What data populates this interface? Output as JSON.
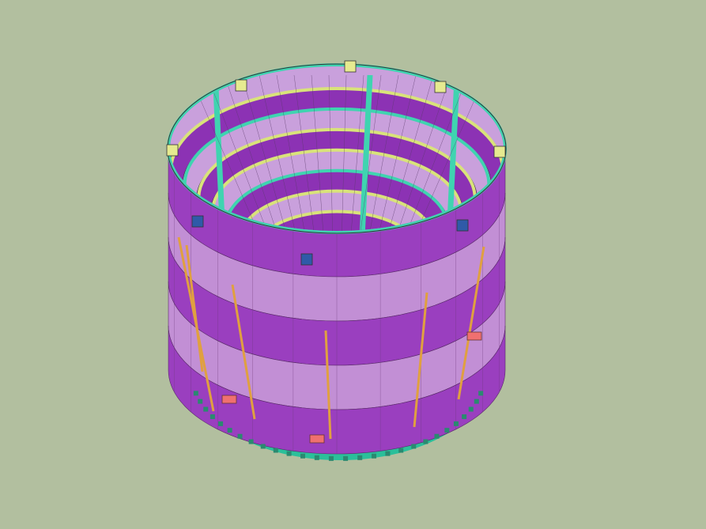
{
  "viewport": {
    "background_color": "#b2bf9f",
    "view": "3d-isometric"
  },
  "model": {
    "object": "cylindrical-tank-shell",
    "shell_band_count": 5,
    "inner_ring_count": 7,
    "outer_vertical_rod_count": 6,
    "colors": {
      "shell_dark": "#9a3fbf",
      "shell_light": "#c28fd5",
      "inner_dark": "#8c32b4",
      "inner_light": "#c9a0dc",
      "stiffener_ring": "#d9e37a",
      "teal_ring": "#3fd4b0",
      "base_plate": "#d8ea80",
      "base_edge": "#2bbf9a",
      "vertical_rod": "#e0a040",
      "lug_red": "#f07070",
      "bracket_blue": "#2f5aa8",
      "bracket_yellow": "#e6ea90"
    }
  }
}
